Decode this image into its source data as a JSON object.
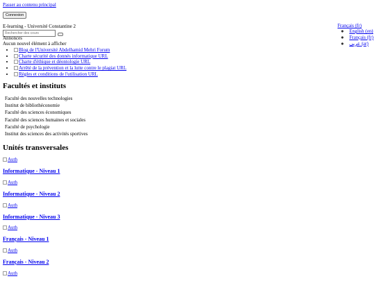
{
  "skip_link": "Passer au contenu principal",
  "login_button": "Connexion",
  "site_name": "E-learning - Université Constantine 2",
  "search": {
    "placeholder": "Rechercher des cours"
  },
  "announcements": {
    "title": "Annonces",
    "empty_text": "Aucun nouvel élément à afficher"
  },
  "links": [
    "Blog de l'Université Abdelhamid Mehri Forum",
    "Charte sécurité des donnés informatique URL",
    "Charte d'éthique et déontologie URL",
    "Arrêté de la prévention et la lutte contre le plagiat URL",
    "Règles et conditions de l'utilisation URL"
  ],
  "language": {
    "current": "Français (fr)",
    "options": [
      "English (en)",
      "Français (fr)",
      "عربي (ar)"
    ]
  },
  "faculties": {
    "heading": "Facultés et instituts",
    "items": [
      "Faculté des nouvelles technologies",
      "Institut de bibliothéconomie",
      "Faculté des sciences économiques",
      "Faculté des sciences humaines et sociales",
      "Faculté de psychologie",
      "Institut des sciences des activités sportives"
    ]
  },
  "units": {
    "heading": "Unités transversales",
    "image_alt": "Auth",
    "items": [
      "Informatique - Niveau 1",
      "Informatique - Niveau 2",
      "Informatique - Niveau 3",
      "Français - Niveau 1",
      "Français - Niveau 2"
    ]
  }
}
